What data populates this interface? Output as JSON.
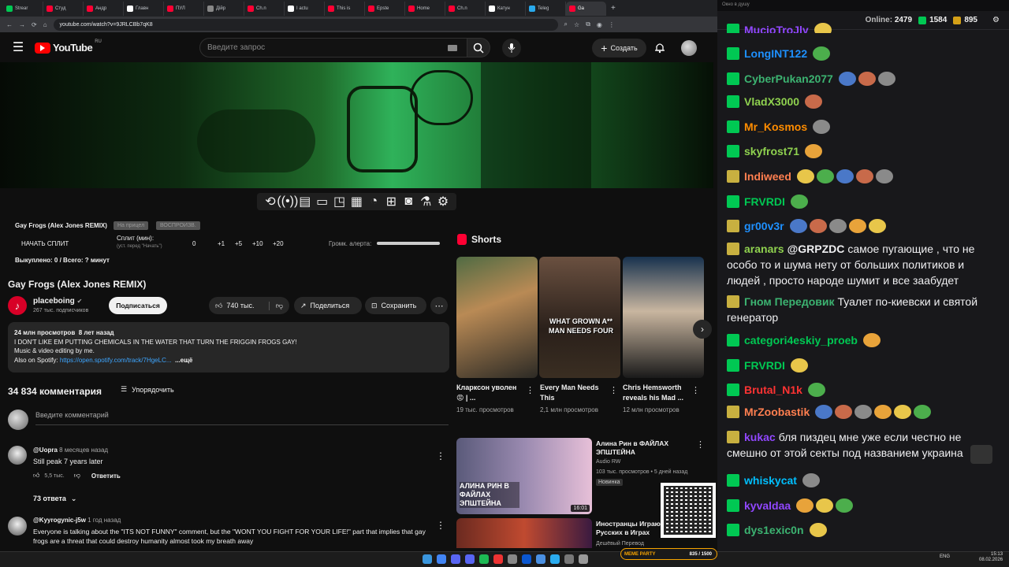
{
  "browser": {
    "tabs": [
      {
        "label": "Strear",
        "color": "#00c853"
      },
      {
        "label": "Студ",
        "color": "#ff0033"
      },
      {
        "label": "Андр",
        "color": "#ff0033"
      },
      {
        "label": "Главн",
        "color": "#ffffff"
      },
      {
        "label": "ПУЛ",
        "color": "#ff0033"
      },
      {
        "label": "Дійр",
        "color": "#888888"
      },
      {
        "label": "Ch.n",
        "color": "#ff0033"
      },
      {
        "label": "I actu",
        "color": "#ffffff"
      },
      {
        "label": "This is",
        "color": "#ff0033"
      },
      {
        "label": "Epste",
        "color": "#ff0033"
      },
      {
        "label": "Home",
        "color": "#ff0033"
      },
      {
        "label": "Ch.n",
        "color": "#ff0033"
      },
      {
        "label": "Катун",
        "color": "#ffffff"
      },
      {
        "label": "Teleg",
        "color": "#29a9eb"
      },
      {
        "label": "Ga",
        "color": "#ff0033"
      }
    ],
    "url": "youtube.com/watch?v=9JRLCBb7qK8"
  },
  "youtube": {
    "logo_text": "YouTube",
    "logo_region": "RU",
    "search_placeholder": "Введите запрос",
    "create_label": "Создать"
  },
  "addon": {
    "title": "Gay Frogs (Alex Jones REMIX)",
    "pill1": "На прицел",
    "pill2": "ВОСПРОИЗВ.",
    "start_split": "НАЧАТЬ СПЛИТ",
    "split_label": "Сплит (мин):",
    "split_hint": "(уст. перед \"Начать\")",
    "split_value": "0",
    "steps": [
      "+1",
      "+5",
      "+10",
      "+20"
    ],
    "volume_label": "Громк. алерта:",
    "bought": "Выкуплено: 0 / Всего: ? минут"
  },
  "video": {
    "title": "Gay Frogs (Alex Jones REMIX)",
    "channel": "placeboing",
    "subscribers": "267 тыс. подписчиков",
    "subscribe": "Подписаться",
    "likes": "740 тыс.",
    "share": "Поделиться",
    "save": "Сохранить",
    "views": "24 млн просмотров",
    "age": "8 лет назад",
    "desc_line1": "I DON'T LIKE EM PUTTING CHEMICALS IN THE WATER THAT TURN THE FRIGGIN FROGS GAY!",
    "desc_line2": "Music & video editing by me.",
    "desc_line3": "Also on Spotify:",
    "desc_link": "https://open.spotify.com/track/7HgeLC...",
    "desc_more": "...ещё"
  },
  "comments": {
    "count": "34 834 комментария",
    "sort": "Упорядочить",
    "input_placeholder": "Введите комментарий",
    "items": [
      {
        "author": "@Uopra",
        "time": "8 месяцев назад",
        "text": "Still peak 7 years later",
        "likes": "5,5 тыс.",
        "reply": "Ответить",
        "replies": "73 ответа"
      },
      {
        "author": "@Kyyrogynic-j5w",
        "time": "1 год назад",
        "text": "Everyone is talking about the \"ITS NOT FUNNY\" comment, but the \"WONT YOU FIGHT FOR YOUR LIFE!\" part that implies that gay frogs are a threat that could destroy humanity almost took my breath away"
      }
    ]
  },
  "shorts": {
    "heading": "Shorts",
    "items": [
      {
        "title": "Кларксон уволен 😡 | ...",
        "views": "19 тыс. просмотров"
      },
      {
        "title": "Every Man Needs This",
        "views": "2,1 млн просмотров",
        "overlay": "WHAT GROWN A** MAN NEEDS FOUR"
      },
      {
        "title": "Chris Hemsworth reveals his Mad ...",
        "views": "12 млн просмотров"
      }
    ]
  },
  "recs": [
    {
      "title": "Алина Рин в ФАЙЛАХ ЭПШТЕЙНА",
      "channel": "Audio RW",
      "meta": "103 тыс. просмотров • 5 дней назад",
      "badge": "Новинка",
      "duration": "16:01",
      "thumb_text": "АЛИНА РИН В ФАЙЛАХ ЭПШТЕЙНА"
    },
    {
      "title": "Иностранцы Играют Русских в Играх",
      "channel": "Дешёвый Перевод"
    }
  ],
  "meme": {
    "label": "MEME PARTY",
    "progress_text": "835 / 1500"
  },
  "chat": {
    "header": "Окно в душу",
    "online_label": "Online:",
    "online": "2479",
    "stat1": "1584",
    "stat2": "895",
    "messages": [
      {
        "user": "MucioTroJly",
        "color": "#9147ff",
        "text": "",
        "emotes": 1
      },
      {
        "user": "LongINT122",
        "color": "#1e90ff",
        "text": "",
        "emotes": 1
      },
      {
        "user": "CyberPukan2077",
        "color": "#3cb371",
        "text": "",
        "emotes": 3
      },
      {
        "user": "VladX3000",
        "color": "#8fd14f",
        "text": "",
        "emotes": 1
      },
      {
        "user": "Mr_Kosmos",
        "color": "#ff8c00",
        "text": "",
        "emotes": 1
      },
      {
        "user": "skyfrost71",
        "color": "#8fd14f",
        "text": "",
        "emotes": 1
      },
      {
        "user": "Indiweed",
        "color": "#ff7f50",
        "text": "",
        "emotes": 5
      },
      {
        "user": "FRVRDI",
        "color": "#00c853",
        "text": "",
        "emotes": 1
      },
      {
        "user": "gr00v3r",
        "color": "#1e90ff",
        "text": "",
        "emotes": 5
      },
      {
        "user": "aranars",
        "color": "#8fd14f",
        "mention": "@GRPZDC",
        "text": "самое пугающие , что не особо то и шума нету от больших политиков и людей , просто народе шумит и все заабудет",
        "emotes": 0
      },
      {
        "user": "Гном Передовик",
        "color": "#3cb371",
        "text": "Туалет по-киевски и святой генератор",
        "emotes": 0
      },
      {
        "user": "categori4eskiy_proeb",
        "color": "#00c853",
        "text": "",
        "emotes": 1
      },
      {
        "user": "FRVRDI",
        "color": "#00c853",
        "text": "",
        "emotes": 1
      },
      {
        "user": "Brutal_N1k",
        "color": "#ff3333",
        "text": "",
        "emotes": 1
      },
      {
        "user": "MrZoobastik",
        "color": "#ff7f50",
        "text": "",
        "emotes": 6
      },
      {
        "user": "kukac",
        "color": "#9147ff",
        "text": "бля пиздец мне уже если честно не смешно от этой секты под названием украина",
        "emotes": 1
      },
      {
        "user": "whiskycat",
        "color": "#00bfff",
        "text": "",
        "emotes": 1
      },
      {
        "user": "kyvaldaa",
        "color": "#9147ff",
        "text": "",
        "emotes": 3
      },
      {
        "user": "dys1exic0n",
        "color": "#3cb371",
        "text": "",
        "emotes": 1
      }
    ]
  },
  "taskbar": {
    "lang": "ENG",
    "time": "15:13",
    "date": "08.02.2026"
  }
}
